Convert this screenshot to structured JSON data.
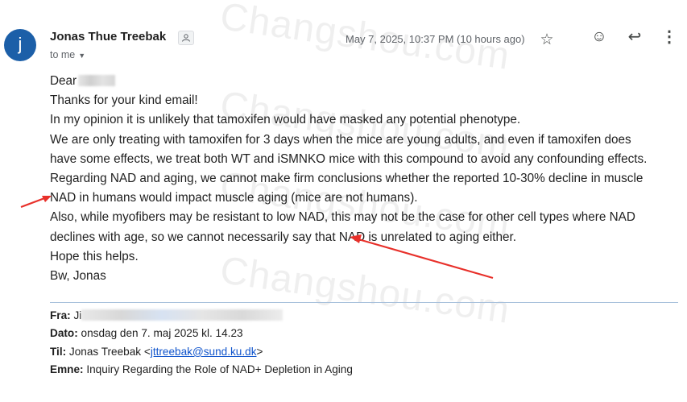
{
  "sender": {
    "avatar_initial": "j",
    "name": "Jonas Thue Treebak",
    "badge_icon": "person-icon",
    "to_label": "to me",
    "date": "May 7, 2025, 10:37 PM (10 hours ago)"
  },
  "actions": {
    "star": "☆",
    "emoji": "☺",
    "reply": "↩",
    "more": "⋮"
  },
  "body": {
    "greeting": "Dear",
    "lines": [
      "Thanks for your kind email!",
      "In my opinion it is unlikely that tamoxifen would have masked any potential phenotype.",
      "We are only treating with tamoxifen for 3 days when the mice are young adults, and even if tamoxifen does",
      "have some effects, we treat both WT and iSMNKO mice with this compound to avoid any confounding effects.",
      "Regarding NAD and aging, we cannot make firm conclusions whether the reported 10-30% decline in muscle",
      "NAD in humans would impact muscle aging (mice are not humans).",
      "Also, while myofibers may be resistant to low NAD, this may not be the case for other cell types where NAD",
      "declines with age, so we cannot necessarily say that NAD is unrelated to aging either.",
      "Hope this helps.",
      "Bw, Jonas"
    ]
  },
  "quoted": {
    "from_label": "Fra:",
    "from_value": "Ji",
    "date_label": "Dato:",
    "date_value": "onsdag den 7. maj 2025 kl. 14.23",
    "to_label": "Til:",
    "to_name": "Jonas Treebak <",
    "to_email": "jttreebak@sund.ku.dk",
    "to_close": ">",
    "subject_label": "Emne:",
    "subject_value": "Inquiry Regarding the Role of NAD+ Depletion in Aging"
  },
  "watermark": "Changshou.com",
  "colors": {
    "avatar": "#1c5fa8",
    "link": "#1155cc",
    "annotation_arrow": "#e8302a"
  }
}
